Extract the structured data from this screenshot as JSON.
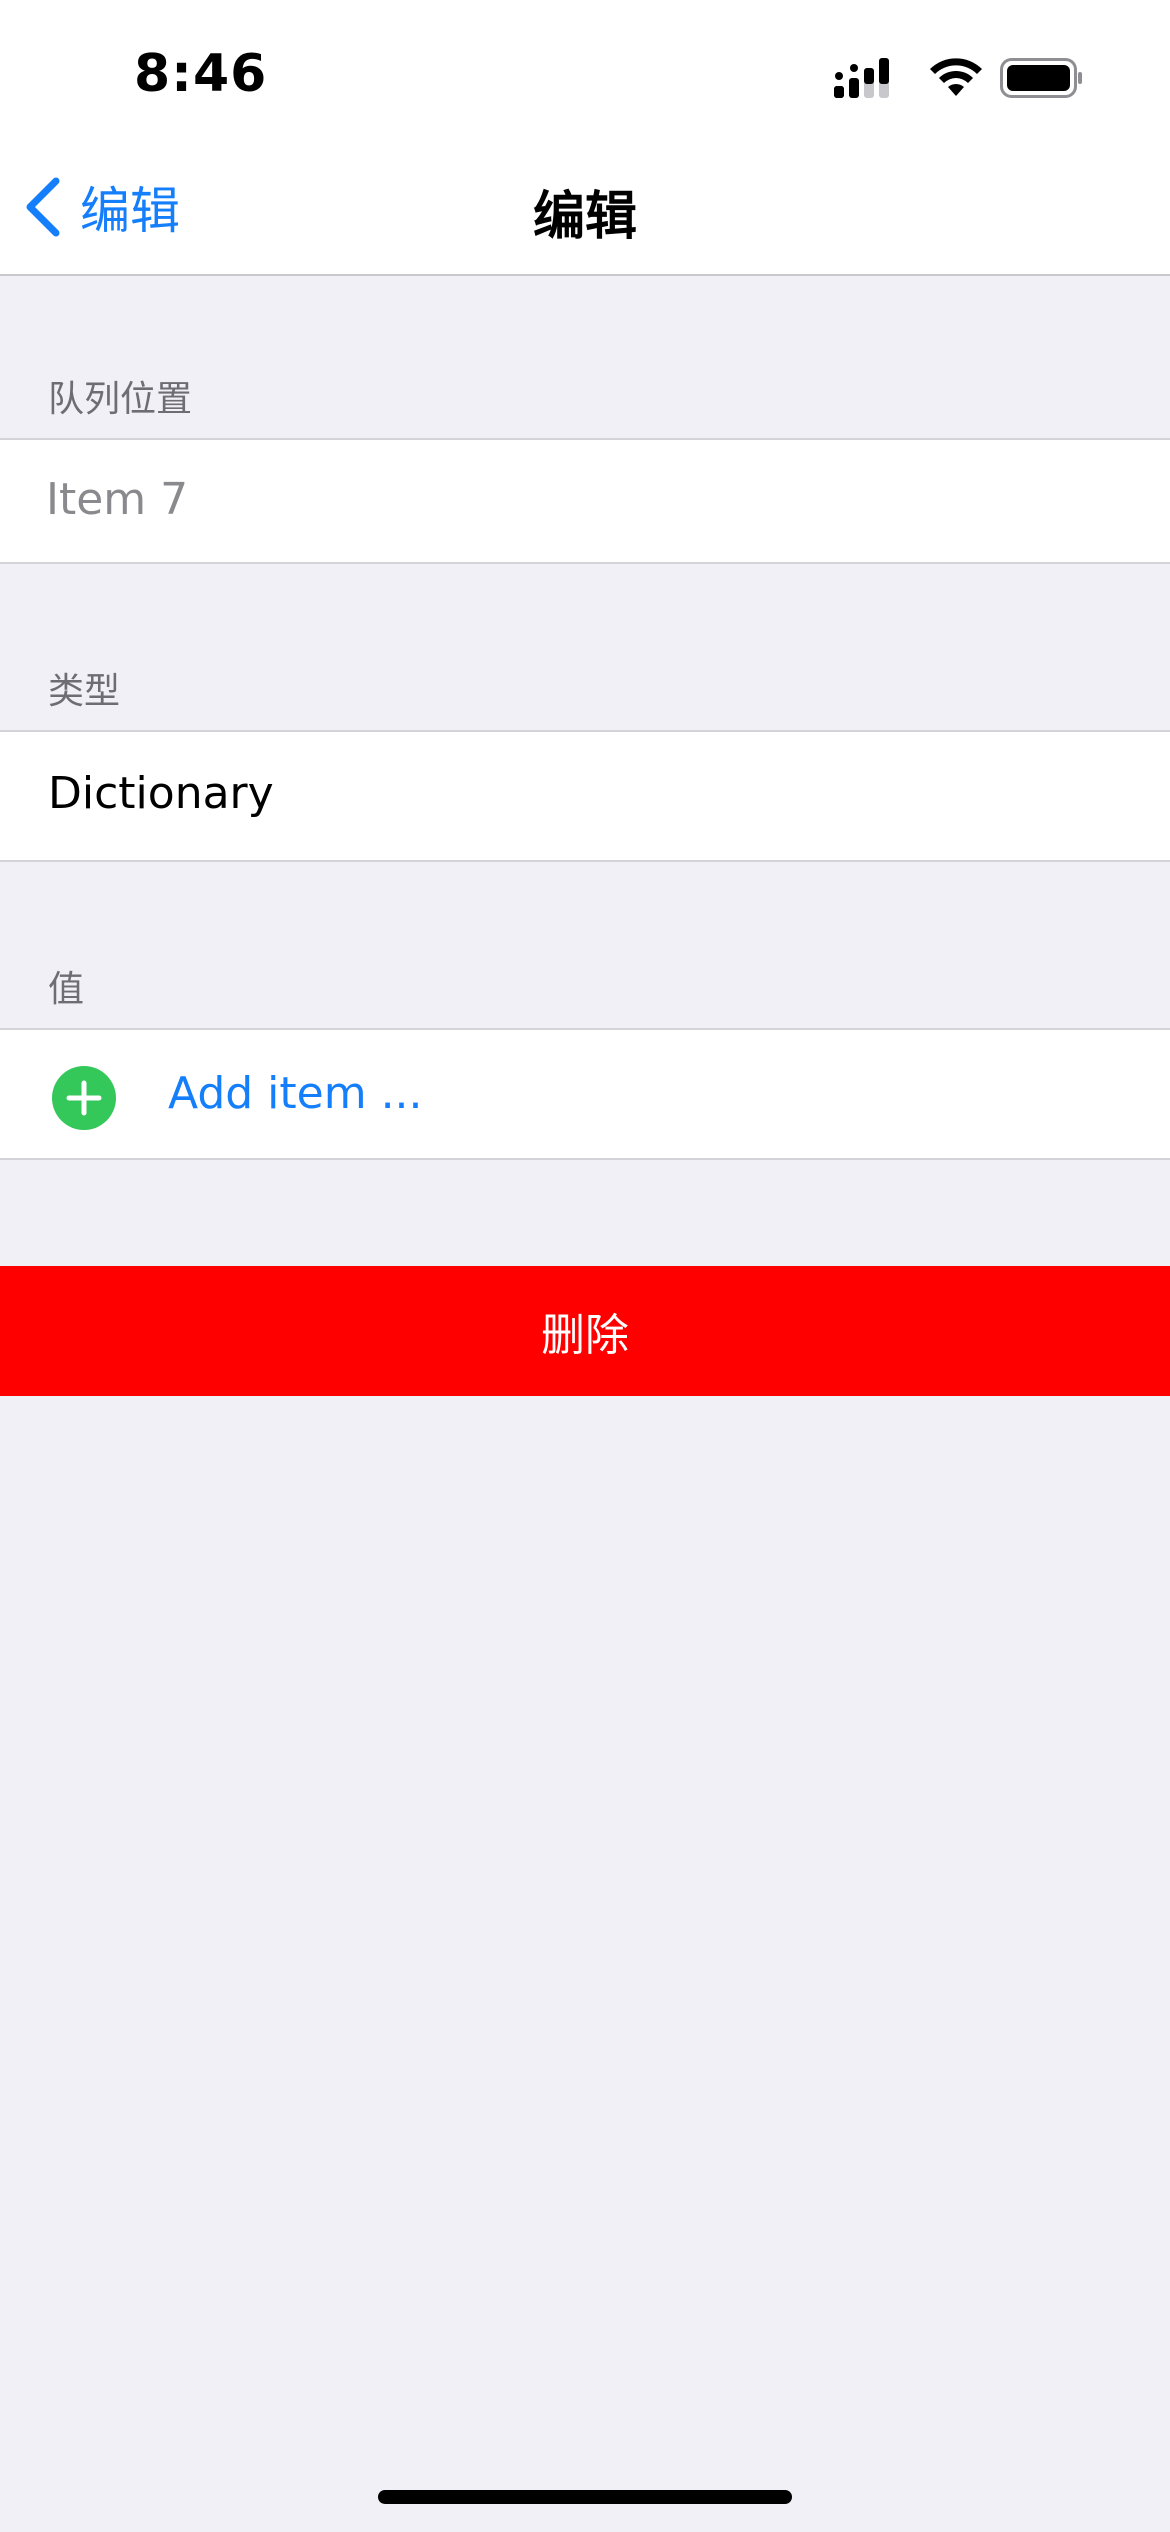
{
  "status_bar": {
    "time": "8:46"
  },
  "nav": {
    "back_label": "编辑",
    "title": "编辑"
  },
  "sections": {
    "queue_position": {
      "header": "队列位置",
      "placeholder": "Item 7"
    },
    "type": {
      "header": "类型",
      "value": "Dictionary"
    },
    "value": {
      "header": "值",
      "add_label": "Add item ..."
    }
  },
  "actions": {
    "delete_label": "删除"
  },
  "colors": {
    "accent": "#157efb",
    "destructive": "#ff0000",
    "add_green": "#34c759",
    "grouped_background": "#f0f0f6"
  },
  "icons": {
    "back": "chevron-left-icon",
    "add": "plus-circle-icon",
    "signal": "cellular-signal-icon",
    "wifi": "wifi-icon",
    "battery": "battery-icon"
  }
}
